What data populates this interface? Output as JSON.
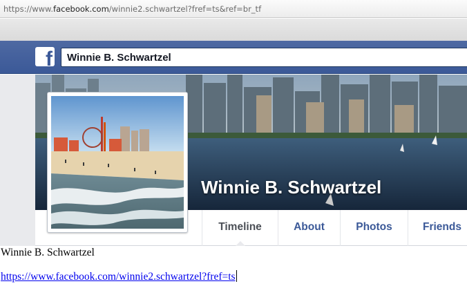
{
  "browser": {
    "url_prefix": "https://www.",
    "url_host": "facebook.com",
    "url_path": "/winnie2.schwartzel?fref=ts&ref=br_tf"
  },
  "fb_header": {
    "logo": "f",
    "search_value": "Winnie B. Schwartzel",
    "brand_color": "#3b5998"
  },
  "profile": {
    "cover_name": "Winnie B. Schwartzel",
    "cover_photo_icon": "city-skyline-harbor",
    "profile_photo_icon": "beach-amusement-park"
  },
  "tabs": [
    {
      "label": "Timeline",
      "active": true
    },
    {
      "label": "About",
      "active": false
    },
    {
      "label": "Photos",
      "active": false
    },
    {
      "label": "Friends",
      "active": false
    }
  ],
  "document": {
    "name": "Winnie B. Schwartzel",
    "link": "https://www.facebook.com/winnie2.schwartzel?fref=ts",
    "link_color": "#0000ee"
  }
}
